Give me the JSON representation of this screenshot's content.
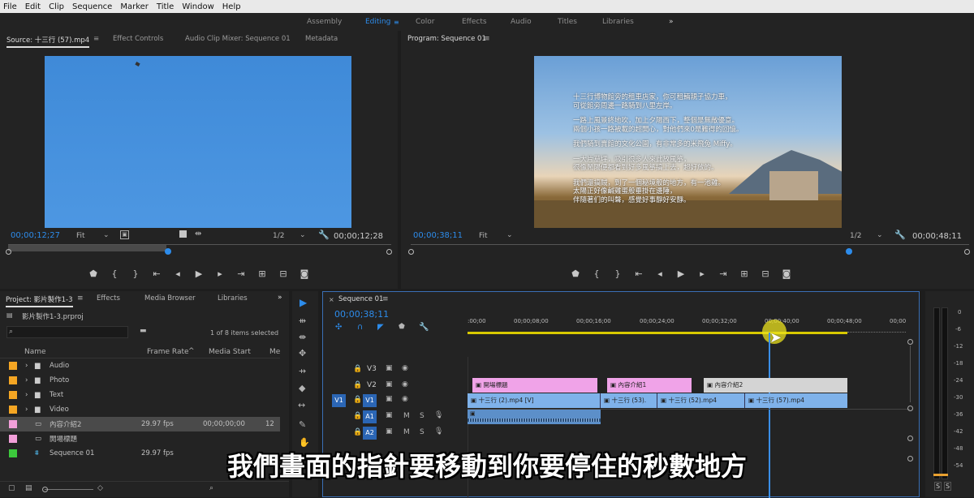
{
  "menu": [
    "File",
    "Edit",
    "Clip",
    "Sequence",
    "Marker",
    "Title",
    "Window",
    "Help"
  ],
  "workspaces": [
    "Assembly",
    "Editing",
    "Color",
    "Effects",
    "Audio",
    "Titles",
    "Libraries"
  ],
  "workspace_more": "»",
  "source": {
    "tabs": [
      "Source: 十三行 (57).mp4",
      "Effect Controls",
      "Audio Clip Mixer: Sequence 01",
      "Metadata"
    ],
    "timecode": "00;00;12;27",
    "fit": "Fit",
    "res": "1/2",
    "duration": "00;00;12;28"
  },
  "program": {
    "tab": "Program: Sequence 01",
    "timecode": "00;00;38;11",
    "fit": "Fit",
    "res": "1/2",
    "duration": "00;00;48;11",
    "text": [
      "十三行博物館旁的租車店家，你可租輛親子協力車，",
      "可從館旁周邊一路騎到八里左岸。",
      "",
      "一路上風景終地吹，加上夕陽西下，整個是無敵優意。",
      "兩個小孩一路被載的超開心，對他們來0是難得的回憶。",
      "",
      "我們騎到賣館的文化公園，有非常多的米飛兔 Miffy。",
      "",
      "一大片草坪，吸引很多人來此放風箏，",
      "很像鬧陽便都看到好多風箏搞上去，超好放的。",
      "",
      "我們還搞賊，到了一個秘境般的地方，有一池雞。",
      "太陽正好像鹹雞蛋般垂掛在邊陲，",
      "伴隨著们的叫聲，感覺好事靜好安靜。"
    ]
  },
  "project": {
    "tabs": [
      "Project: 影片製作1-3",
      "Effects",
      "Media Browser",
      "Libraries"
    ],
    "file": "影片製作1-3.prproj",
    "selected": "1 of 8 items selected",
    "cols": [
      "Name",
      "Frame Rate",
      "Media Start",
      "Me"
    ],
    "items": [
      {
        "name": "Audio",
        "rate": "",
        "start": "",
        "color": "#f5a623",
        "type": "folder"
      },
      {
        "name": "Photo",
        "rate": "",
        "start": "",
        "color": "#f5a623",
        "type": "folder"
      },
      {
        "name": "Text",
        "rate": "",
        "start": "",
        "color": "#f5a623",
        "type": "folder"
      },
      {
        "name": "Video",
        "rate": "",
        "start": "",
        "color": "#f5a623",
        "type": "folder"
      },
      {
        "name": "內容介紹2",
        "rate": "29.97 fps",
        "start": "00;00;00;00",
        "color": "#f29fd9",
        "type": "title",
        "extra": "12"
      },
      {
        "name": "開場標題",
        "rate": "",
        "start": "",
        "color": "#f29fd9",
        "type": "title"
      },
      {
        "name": "Sequence 01",
        "rate": "29.97 fps",
        "start": "",
        "color": "#3cc83c",
        "type": "seq"
      }
    ]
  },
  "timeline": {
    "tab": "Sequence 01",
    "timecode": "00;00;38;11",
    "ticks": [
      ":00;00",
      "00;00;08;00",
      "00;00;16;00",
      "00;00;24;00",
      "00;00;32;00",
      "00;00;40;00",
      "00;00;48;00",
      "00;00"
    ],
    "tracks": [
      "V3",
      "V2",
      "V1",
      "A1",
      "A2"
    ],
    "v2clips": [
      "開場標題",
      "內容介紹1",
      "內容介紹2"
    ],
    "v1clips": [
      "十三行 (2).mp4 [V]",
      "十三行 (53).",
      "十三行 (52).mp4",
      "十三行 (57).mp4"
    ]
  },
  "meter": {
    "labels": [
      "0",
      "-6",
      "-12",
      "-18",
      "-24",
      "-30",
      "-36",
      "-42",
      "-48",
      "-54"
    ],
    "solo": [
      "S",
      "S"
    ]
  },
  "subtitle": "我們畫面的指針要移動到你要停住的秒數地方"
}
